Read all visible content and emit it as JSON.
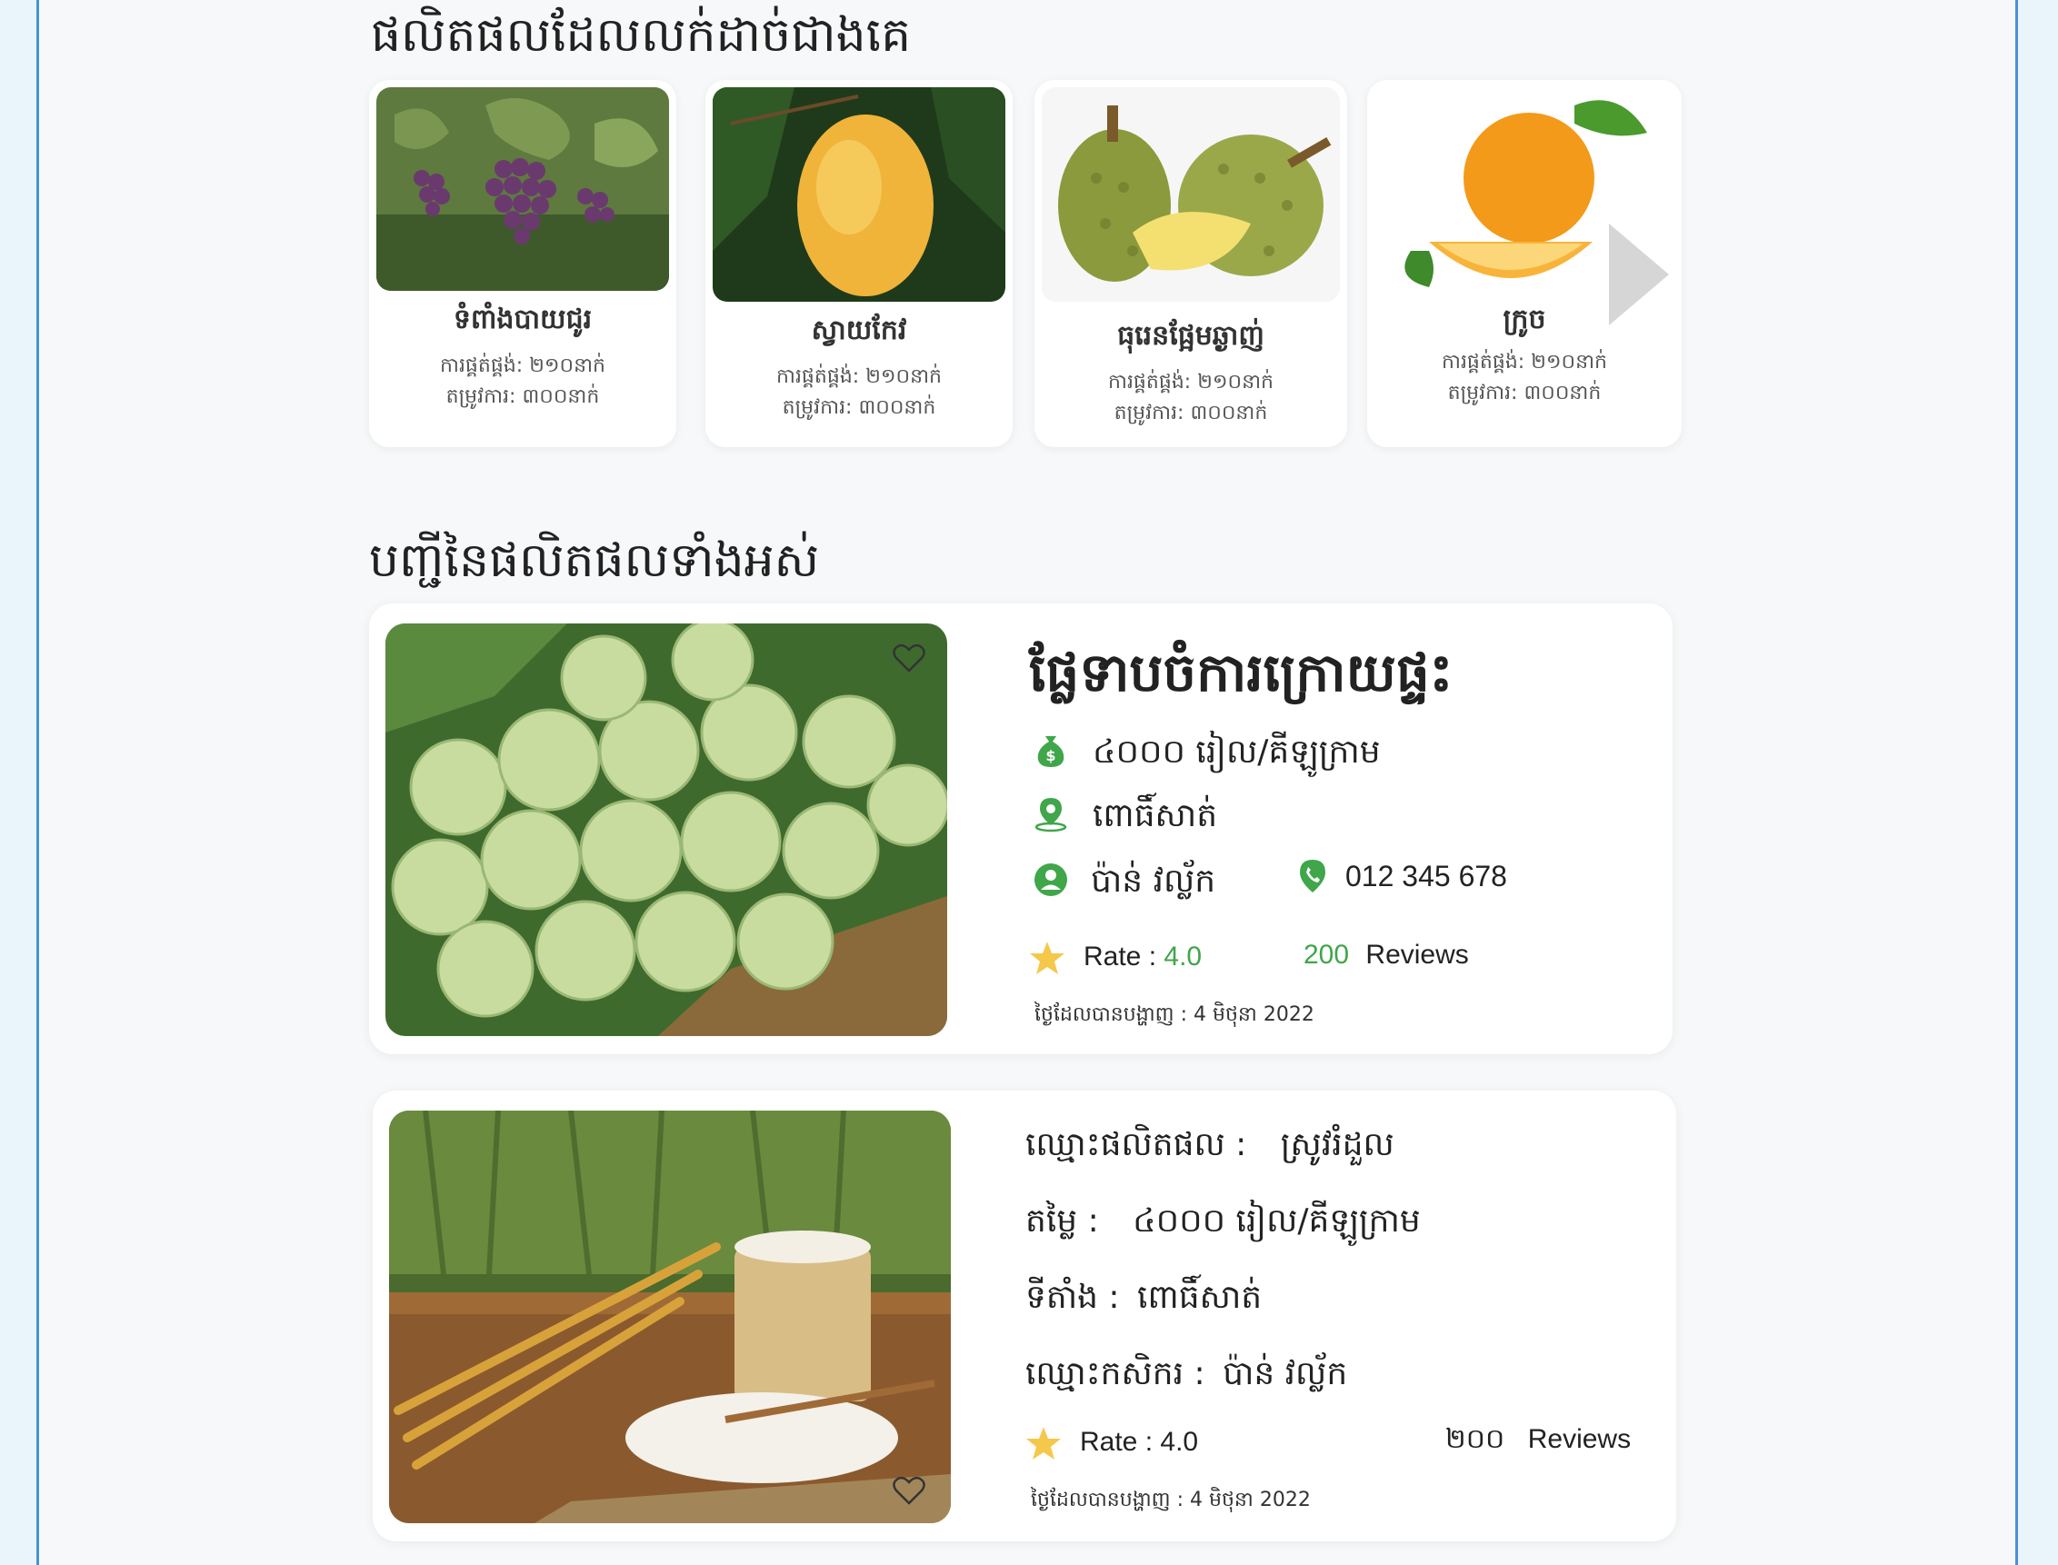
{
  "best_selling": {
    "title": "ផលិតផលដែលលក់ដាច់ជាងគេ",
    "items": [
      {
        "name": "ទំពាំងបាយជូរ",
        "supply": "ការផ្គត់ផ្គង់: ២១០នាក់",
        "demand": "តម្រូវការ: ៣០០នាក់"
      },
      {
        "name": "ស្វាយកែវ",
        "supply": "ការផ្គត់ផ្គង់: ២១០នាក់",
        "demand": "តម្រូវការ: ៣០០នាក់"
      },
      {
        "name": "ធុរេនផ្អែមឆ្ងាញ់",
        "supply": "ការផ្គត់ផ្គង់: ២១០នាក់",
        "demand": "តម្រូវការ: ៣០០នាក់"
      },
      {
        "name": "ក្រូច",
        "supply": "ការផ្គត់ផ្គង់: ២១០នាក់",
        "demand": "តម្រូវការ: ៣០០នាក់"
      }
    ]
  },
  "all_products": {
    "title": "បញ្ជីនៃផលិតផលទាំងអស់",
    "card1": {
      "name": "ផ្លែទាបចំការក្រោយផ្ទះ",
      "price": "៤០០០ រៀល/គីឡូក្រាម",
      "location": "ពោធិ៍សាត់",
      "farmer": "ប៉ាន់ វល្ល័ក",
      "phone": "012 345 678",
      "rate_label": "Rate :",
      "rate_value": "4.0",
      "reviews_count": "200",
      "reviews_label": "Reviews",
      "date": "ថ្ងៃដែលបានបង្ហាញ : 4 មិថុនា 2022"
    },
    "card2": {
      "name_label": "ឈ្មោះផលិតផល :",
      "name": "ស្រូវរំដួល",
      "price_label": "តម្លៃ :",
      "price": "៤០០០ រៀល/គីឡូក្រាម",
      "location_label": "ទីតាំង :",
      "location": "ពោធិ៍សាត់",
      "farmer_label": "ឈ្មោះកសិករ :",
      "farmer": "ប៉ាន់ វល្ល័ក",
      "rate_label": "Rate :",
      "rate_value": "4.0",
      "reviews_count": "២០០",
      "reviews_label": "Reviews",
      "date": "ថ្ងៃដែលបានបង្ហាញ : 4 មិថុនា 2022"
    }
  },
  "icons": {
    "price": "money-bag-icon",
    "location": "location-pin-icon",
    "farmer": "user-icon",
    "phone": "phone-icon",
    "rating": "star-icon",
    "favorite": "heart-icon",
    "next": "next-arrow-icon"
  },
  "colors": {
    "accent_green": "#3fa64a",
    "star": "#f5c84c",
    "frame_border": "#4a90d9"
  }
}
